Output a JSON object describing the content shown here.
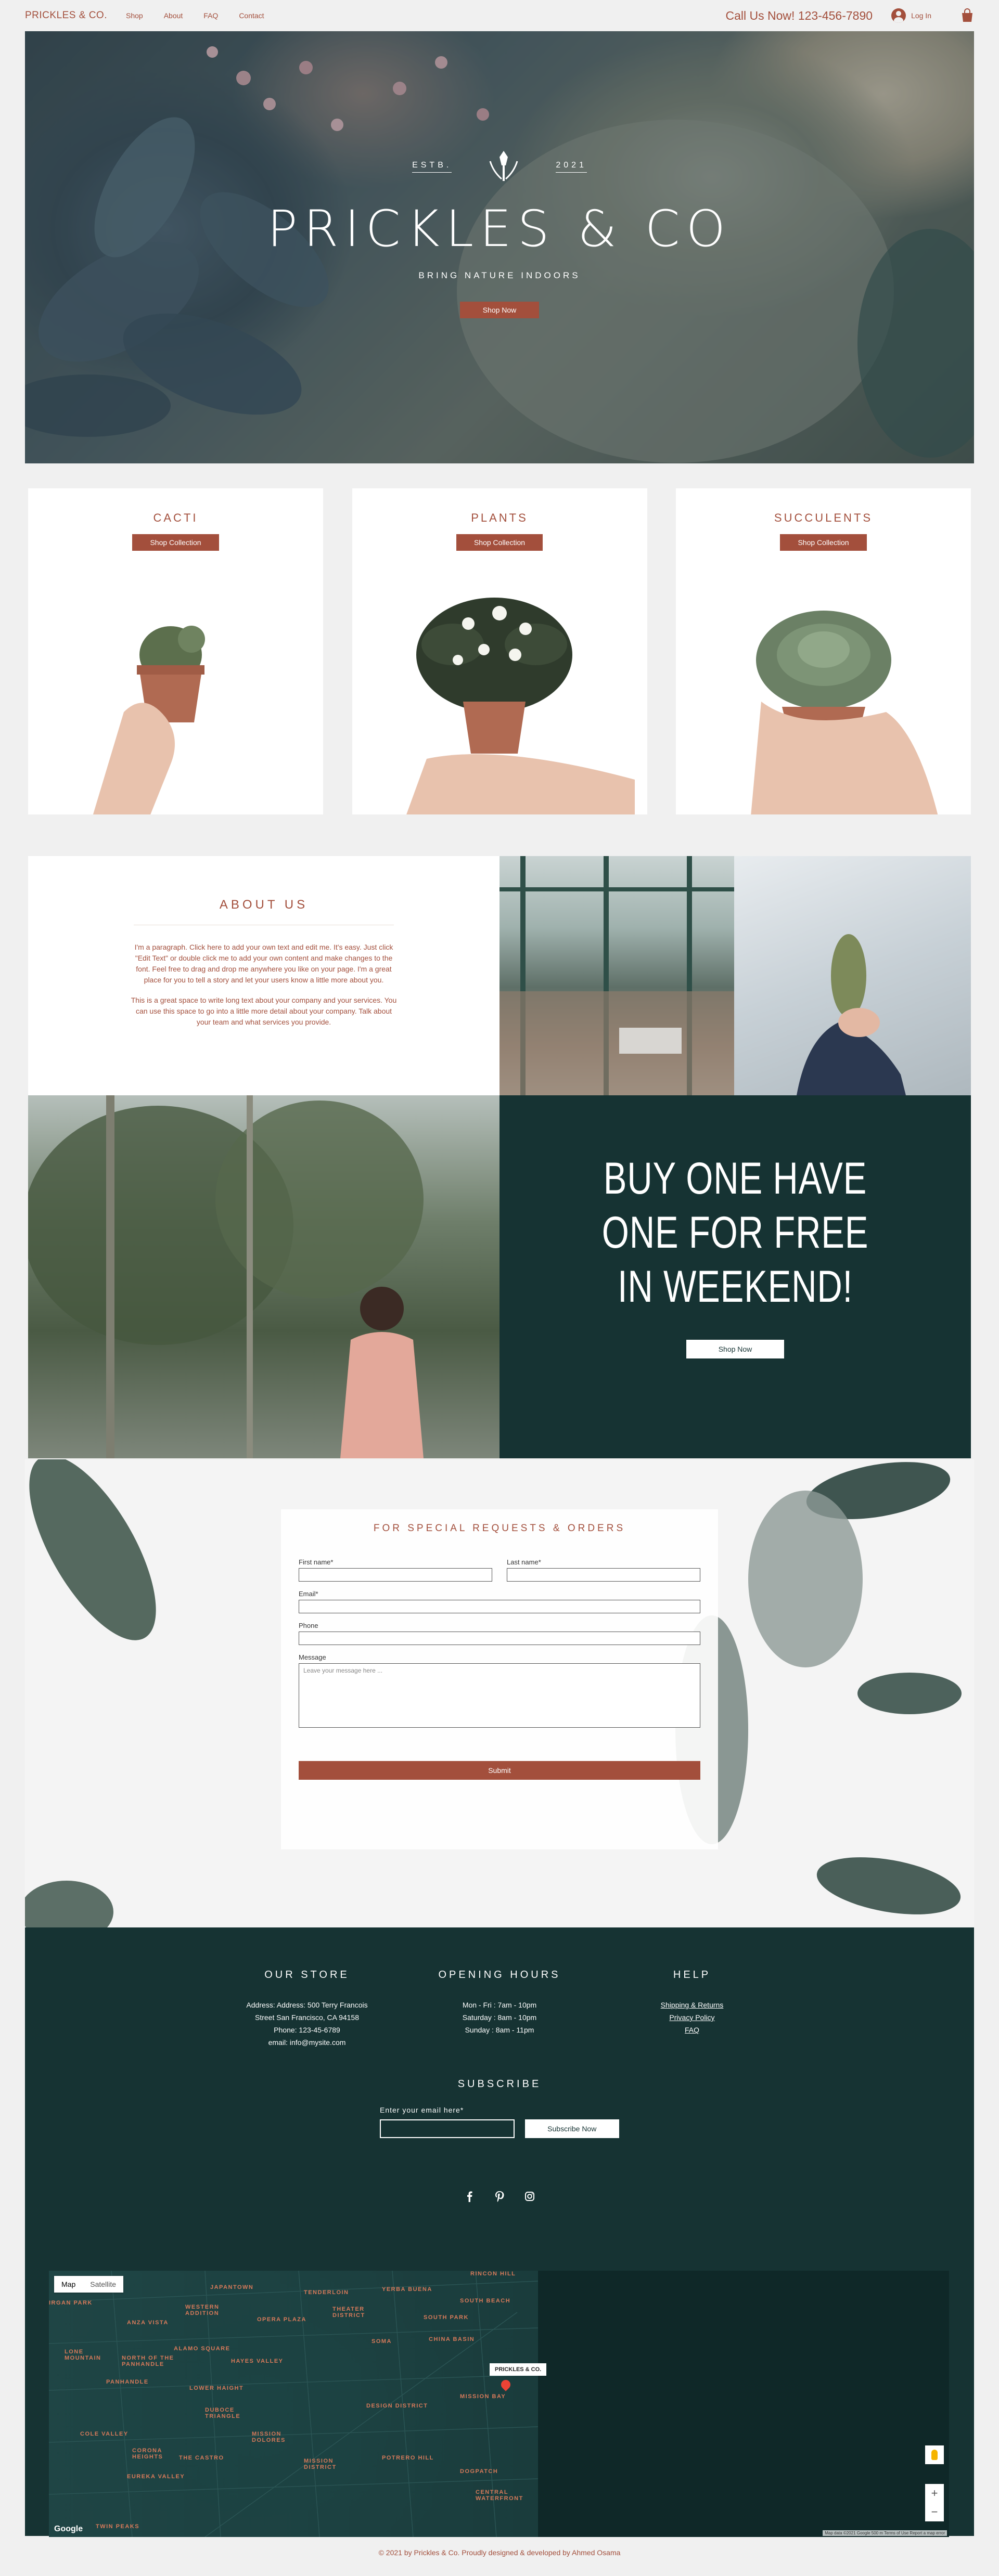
{
  "header": {
    "brand": "PRICKLES & CO.",
    "nav": [
      "Shop",
      "About",
      "FAQ",
      "Contact"
    ],
    "phone": "Call Us Now! 123-456-7890",
    "login": "Log In"
  },
  "hero": {
    "estb_left": "ESTB.",
    "estb_right": "2021",
    "title": "PRICKLES & CO",
    "subtitle": "BRING NATURE INDOORS",
    "cta": "Shop Now"
  },
  "collections": [
    {
      "title": "CACTI",
      "cta": "Shop Collection"
    },
    {
      "title": "PLANTS",
      "cta": "Shop Collection"
    },
    {
      "title": "SUCCULENTS",
      "cta": "Shop Collection"
    }
  ],
  "about": {
    "title": "ABOUT US",
    "p1": "I'm a paragraph. Click here to add your own text and edit me. It's easy. Just click \"Edit Text\" or double click me to add your own content and make changes to the font. Feel free to drag and drop me anywhere you like on your page. I'm a great place for you to tell a story and let your users know a little more about you.",
    "p2": "This is a great space to write long text about your company and your services. You can use this space to go into a little more detail about your company. Talk about your team and what services you provide."
  },
  "promo": {
    "line1": "BUY ONE HAVE",
    "line2": "ONE FOR FREE",
    "line3": "IN WEEKEND!",
    "cta": "Shop Now"
  },
  "contact": {
    "title": "FOR SPECIAL REQUESTS & ORDERS",
    "first_name": "First name*",
    "last_name": "Last name*",
    "email": "Email*",
    "phone": "Phone",
    "message": "Message",
    "message_placeholder": "Leave your message here ...",
    "submit": "Submit"
  },
  "footer": {
    "store_title": "OUR STORE",
    "store_lines": [
      "Address: Address: 500 Terry Francois",
      "Street San Francisco, CA 94158",
      "Phone: 123-45-6789",
      "email: info@mysite.com"
    ],
    "hours_title": "OPENING HOURS",
    "hours_lines": [
      "Mon - Fri : 7am - 10pm",
      "Saturday : 8am - 10pm",
      "Sunday : 8am - 11pm"
    ],
    "help_title": "HELP",
    "help_links": [
      "Shipping & Returns",
      "Privacy Policy",
      "FAQ"
    ],
    "subscribe_title": "SUBSCRIBE",
    "subscribe_label": "Enter your email here*",
    "subscribe_cta": "Subscribe Now",
    "socials": [
      "facebook-icon",
      "pinterest-icon",
      "instagram-icon"
    ]
  },
  "map": {
    "tab_map": "Map",
    "tab_satellite": "Satellite",
    "pin_label": "PRICKLES & CO.",
    "google": "Google",
    "terms": "Map data ©2021 Google  500 m  Terms of Use  Report a map error",
    "labels": [
      "RINCON HILL",
      "JAPANTOWN",
      "TENDERLOIN",
      "YERBA BUENA",
      "IRGAN PARK",
      "WESTERN ADDITION",
      "OPERA PLAZA",
      "THEATER DISTRICT",
      "SOUTH BEACH",
      "ANZA VISTA",
      "SOUTH PARK",
      "SOMA",
      "CHINA BASIN",
      "LONE MOUNTAIN",
      "ALAMO SQUARE",
      "NORTH OF THE PANHANDLE",
      "HAYES VALLEY",
      "PANHANDLE",
      "LOWER HAIGHT",
      "MISSION BAY",
      "DESIGN DISTRICT",
      "DUBOCE TRIANGLE",
      "COLE VALLEY",
      "MISSION DOLORES",
      "CORONA HEIGHTS",
      "THE CASTRO",
      "POTRERO HILL",
      "EUREKA VALLEY",
      "MISSION DISTRICT",
      "DOGPATCH",
      "CENTRAL WATERFRONT",
      "TWIN PEAKS"
    ]
  },
  "copyright": "© 2021 by Prickles & Co. Proudly designed & developed by Ahmed Osama"
}
